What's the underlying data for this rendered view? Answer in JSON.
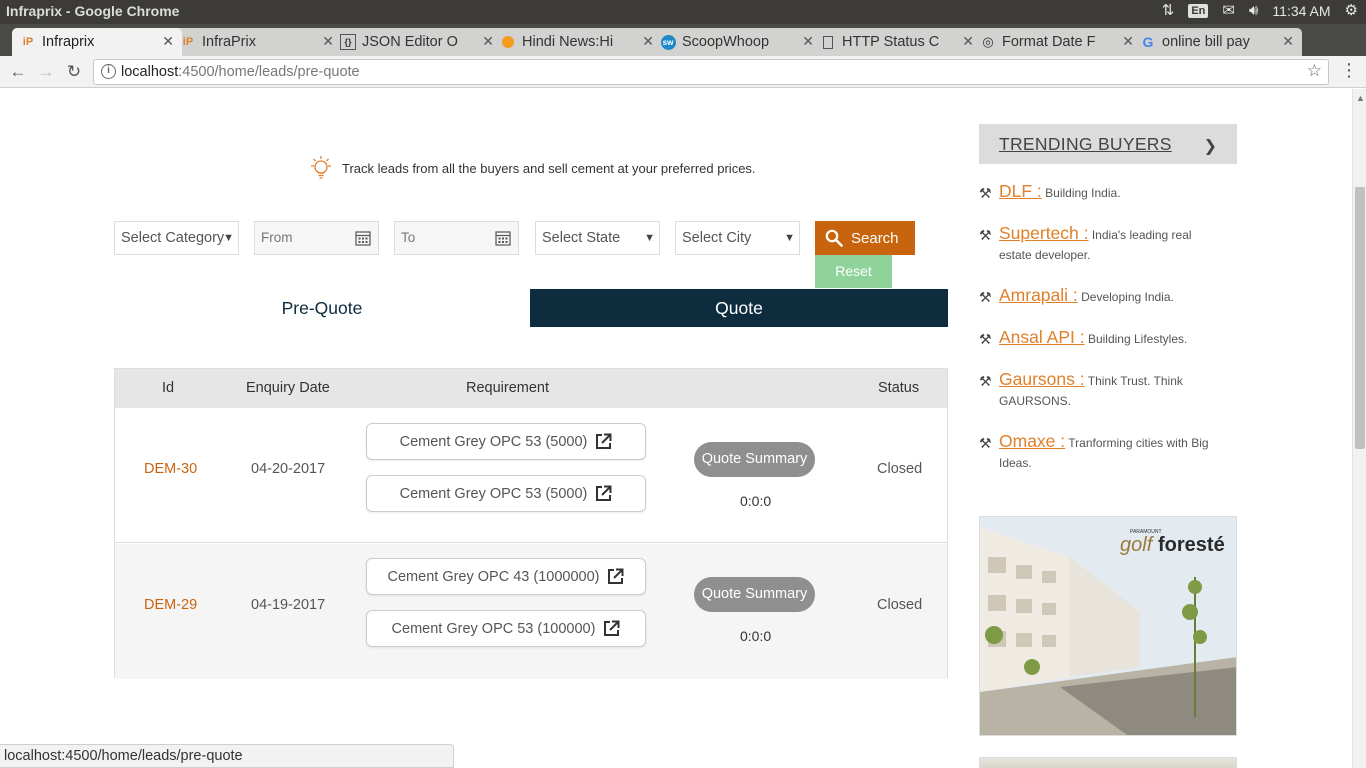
{
  "window": {
    "title": "Infraprix - Google Chrome"
  },
  "system_tray": {
    "lang": "En",
    "time": "11:34 AM"
  },
  "tabs": [
    {
      "label": "Infraprix",
      "favicon": "infraprix-icon",
      "active": true
    },
    {
      "label": "InfraPrix",
      "favicon": "infraprix-icon",
      "active": false
    },
    {
      "label": "JSON Editor O",
      "favicon": "json-icon",
      "active": false
    },
    {
      "label": "Hindi News:Hi",
      "favicon": "orange-dot-icon",
      "active": false
    },
    {
      "label": "ScoopWhoop",
      "favicon": "sw-icon",
      "active": false
    },
    {
      "label": "HTTP Status C",
      "favicon": "page-icon",
      "active": false
    },
    {
      "label": "Format Date F",
      "favicon": "globe-icon",
      "active": false
    },
    {
      "label": "online bill pay",
      "favicon": "google-icon",
      "active": false
    }
  ],
  "address": {
    "host": "localhost",
    "path": ":4500/home/leads/pre-quote"
  },
  "hint": {
    "text": "Track leads from all the buyers and sell cement at your preferred prices."
  },
  "filters": {
    "category": "Select Category",
    "from_placeholder": "From",
    "to_placeholder": "To",
    "state": "Select State",
    "city": "Select City",
    "search_label": "Search",
    "reset_label": "Reset"
  },
  "toggle": {
    "pre_quote": "Pre-Quote",
    "quote": "Quote"
  },
  "table": {
    "headers": {
      "id": "Id",
      "date": "Enquiry Date",
      "requirement": "Requirement",
      "status": "Status"
    },
    "rows": [
      {
        "id": "DEM-30",
        "date": "04-20-2017",
        "requirements": [
          "Cement Grey OPC 53 (5000)",
          "Cement Grey OPC 53 (5000)"
        ],
        "quote_summary": "Quote Summary",
        "quote_value": "0:0:0",
        "status": "Closed"
      },
      {
        "id": "DEM-29",
        "date": "04-19-2017",
        "requirements": [
          "Cement Grey OPC 43 (1000000)",
          "Cement Grey OPC 53 (100000)"
        ],
        "quote_summary": "Quote Summary",
        "quote_value": "0:0:0",
        "status": "Closed"
      }
    ]
  },
  "sidebar": {
    "title": "TRENDING BUYERS",
    "buyers": [
      {
        "name": "DLF :",
        "desc": "Building India."
      },
      {
        "name": "Supertech :",
        "desc": "India's leading real estate developer."
      },
      {
        "name": "Amrapali :",
        "desc": "Developing India."
      },
      {
        "name": "Ansal API :",
        "desc": "Building Lifestyles."
      },
      {
        "name": "Gaursons :",
        "desc": "Think Trust. Think GAURSONS."
      },
      {
        "name": "Omaxe :",
        "desc": "Tranforming cities with Big Ideas."
      }
    ],
    "ad": {
      "brand_prefix": "golf",
      "brand_suffix": "foresté",
      "tagline": "PARAMOUNT"
    }
  },
  "statusbar": {
    "text": "localhost:4500/home/leads/pre-quote"
  },
  "colors": {
    "accent": "#c9640e",
    "navy": "#0d2d3f",
    "reset": "#8fd39a",
    "buyer_link": "#e0802a"
  }
}
